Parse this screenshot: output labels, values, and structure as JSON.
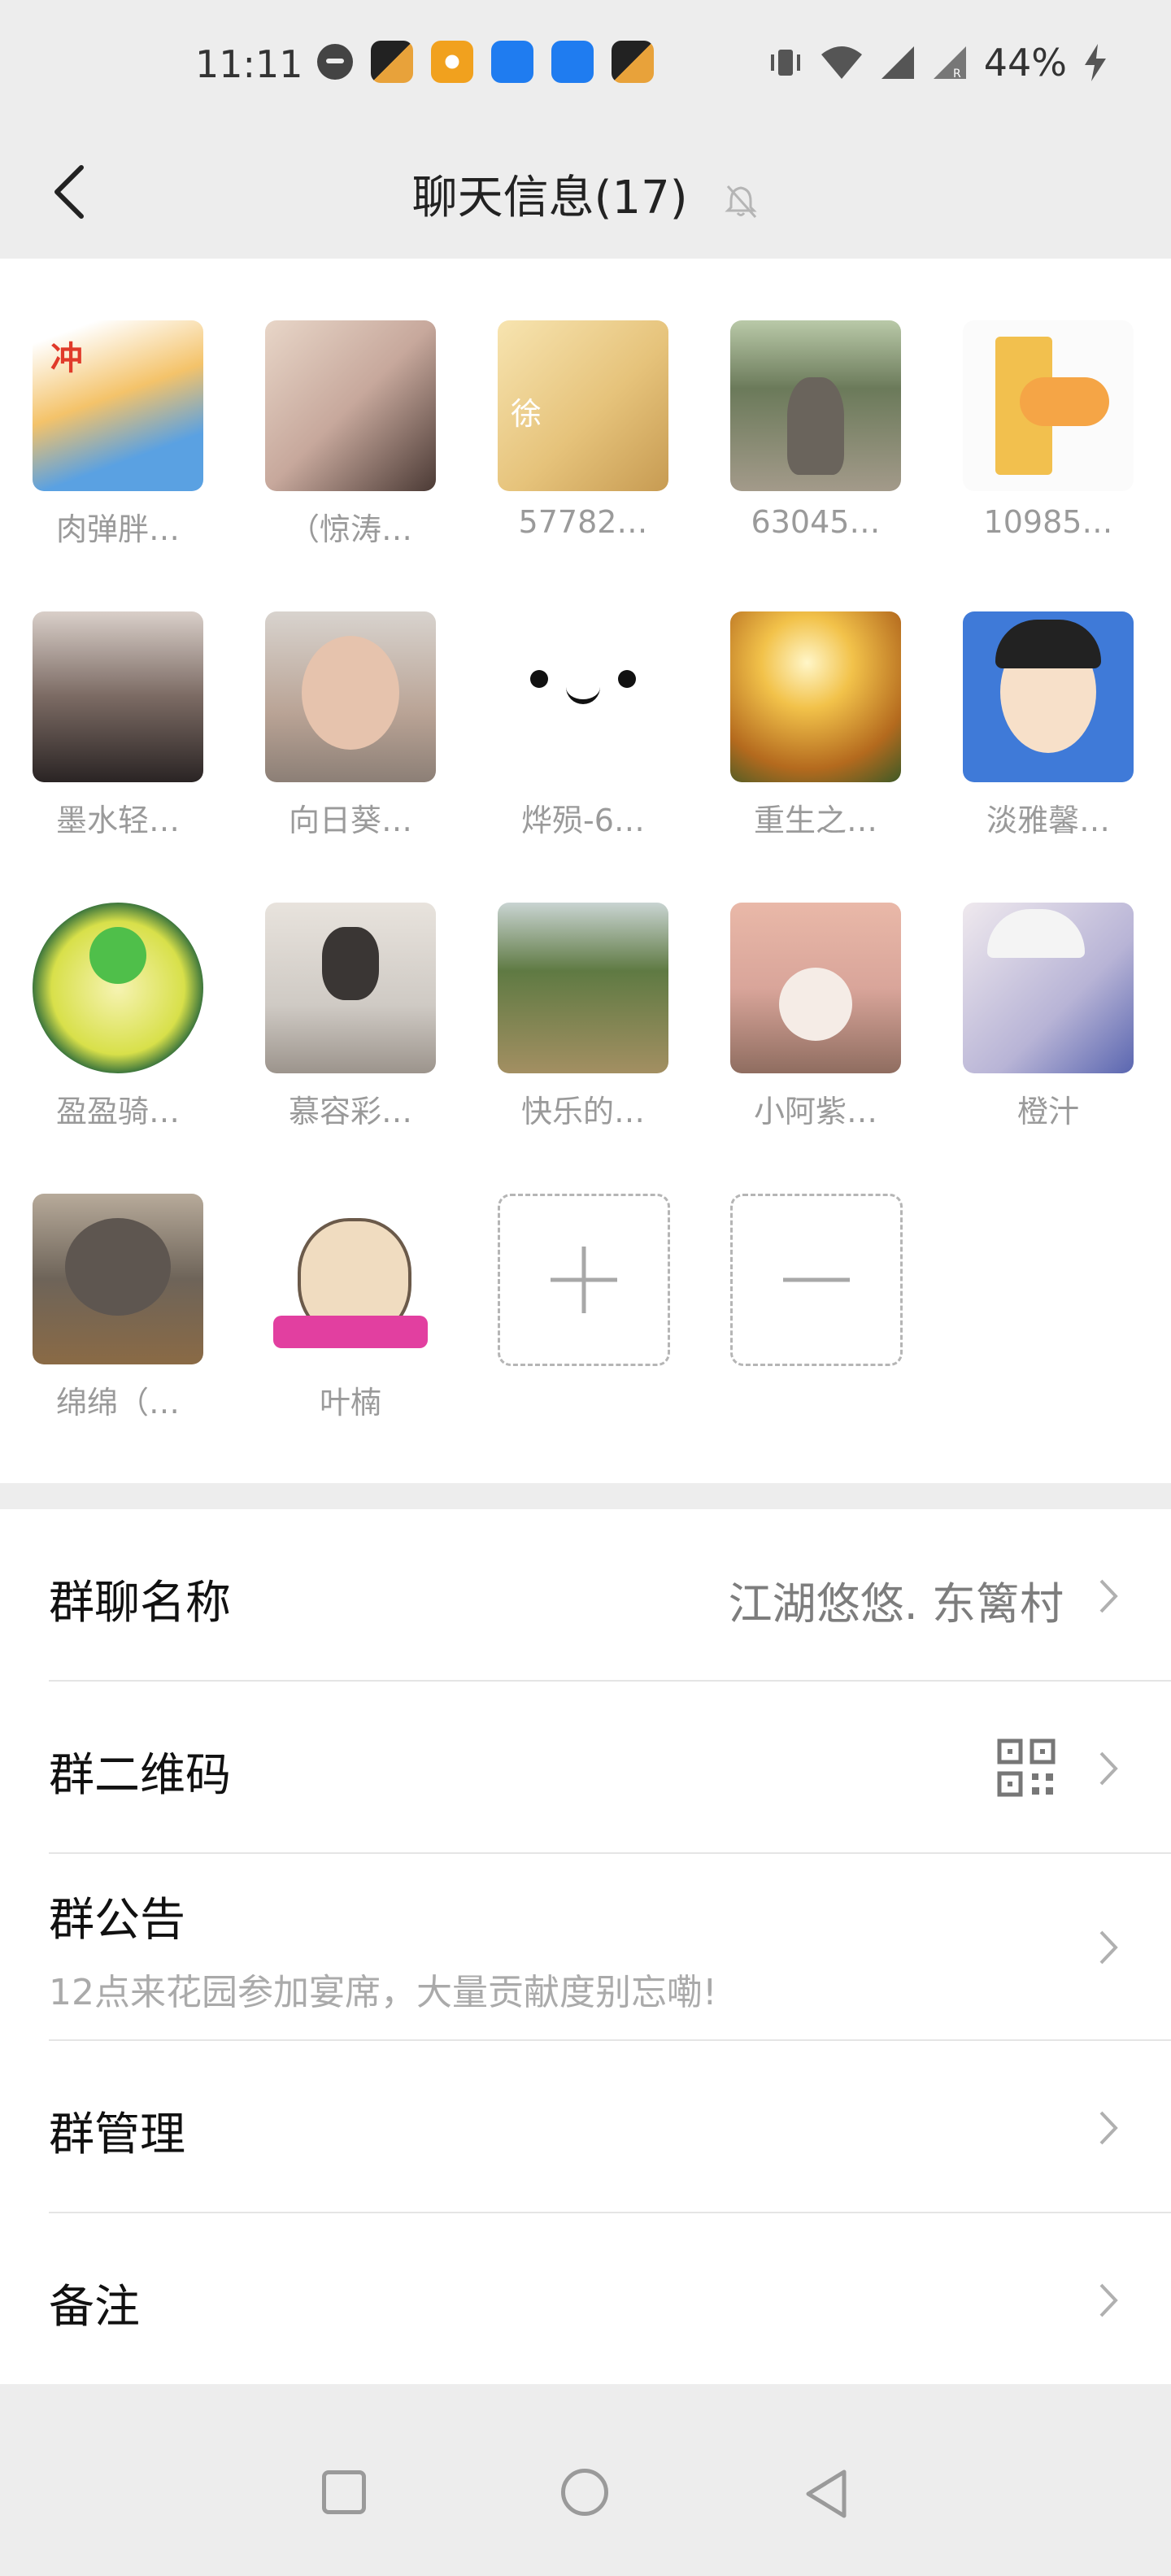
{
  "status_bar": {
    "time": "11:11",
    "battery_percent": "44%",
    "icons": [
      "message-icon",
      "app-icon",
      "app-icon",
      "app-icon",
      "app-icon",
      "app-icon",
      "vibrate-icon",
      "wifi-icon",
      "signal-icon",
      "signal-roaming-icon",
      "charging-icon"
    ]
  },
  "header": {
    "title": "聊天信息(17)",
    "back_icon": "back-arrow-icon",
    "mute_icon": "bell-off-icon"
  },
  "members": [
    {
      "name": "肉弹胖…",
      "avatar_color": "#f4c36a"
    },
    {
      "name": "（惊涛…",
      "avatar_color": "#c7a89c"
    },
    {
      "name": "57782…",
      "avatar_color": "#e6c37b"
    },
    {
      "name": "63045…",
      "avatar_color": "#5f6a52"
    },
    {
      "name": "10985…",
      "avatar_color": "#f2c04e"
    },
    {
      "name": "墨水轻…",
      "avatar_color": "#4a3d3a"
    },
    {
      "name": "向日葵…",
      "avatar_color": "#b9a395"
    },
    {
      "name": "烨殒-6…",
      "avatar_color": "#ffffff"
    },
    {
      "name": "重生之…",
      "avatar_color": "#e0a23d"
    },
    {
      "name": "淡雅馨…",
      "avatar_color": "#3f7ad8"
    },
    {
      "name": "盈盈骑…",
      "avatar_color": "#d8e04a"
    },
    {
      "name": "慕容彩…",
      "avatar_color": "#cfcac4"
    },
    {
      "name": "快乐的…",
      "avatar_color": "#7b8a55"
    },
    {
      "name": "小阿紫…",
      "avatar_color": "#d9a59a"
    },
    {
      "name": "橙汁",
      "avatar_color": "#b8b4d6"
    },
    {
      "name": "绵绵（…",
      "avatar_color": "#6e6459"
    },
    {
      "name": "叶楠",
      "avatar_color": "#f0dcc0"
    }
  ],
  "add_member_icon": "plus-icon",
  "remove_member_icon": "minus-icon",
  "settings": {
    "group_name_label": "群聊名称",
    "group_name_value": "江湖悠悠. 东篱村",
    "qr_code_label": "群二维码",
    "qr_icon": "qr-code-icon",
    "announcement_label": "群公告",
    "announcement_text": "12点来花园参加宴席，大量贡献度别忘嘞!",
    "manage_label": "群管理",
    "remark_label": "备注"
  },
  "nav_bar": {
    "icons": [
      "recent-apps-icon",
      "home-icon",
      "back-icon"
    ]
  }
}
